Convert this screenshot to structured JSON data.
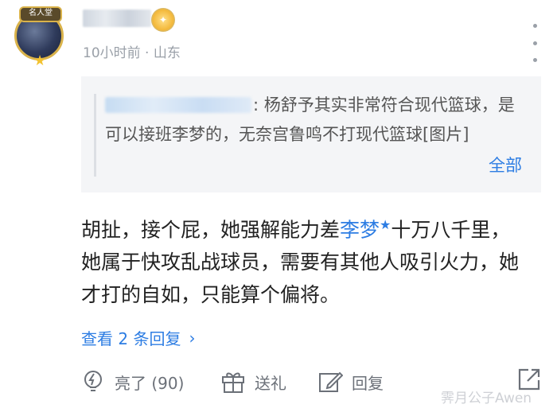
{
  "author": {
    "avatar_badge": "名人堂",
    "meta": "10小时前 · 山东"
  },
  "quote": {
    "text": ": 杨舒予其实非常符合现代篮球，是可以接班李梦的，无奈宫鲁鸣不打现代篮球[图片]",
    "more_label": "全部"
  },
  "comment": {
    "text_before": "胡扯，接个屁，她强解能力差",
    "mention": "李梦",
    "text_after": "十万八千里，她属于快攻乱战球员，需要有其他人吸引火力，她才打的自如，只能算个偏将。"
  },
  "replies": {
    "label": "查看 2 条回复"
  },
  "actions": {
    "like_label": "亮了 (90)",
    "gift_label": "送礼",
    "reply_label": "回复"
  },
  "watermark": "霁月公子Awen",
  "icons": [
    "more-icon",
    "lightbulb-icon",
    "gift-icon",
    "edit-icon",
    "share-icon",
    "chevron-right-icon"
  ],
  "colors": {
    "link": "#2d7de3",
    "muted": "#9aa0a8",
    "quote_bg": "#f4f5f7"
  }
}
